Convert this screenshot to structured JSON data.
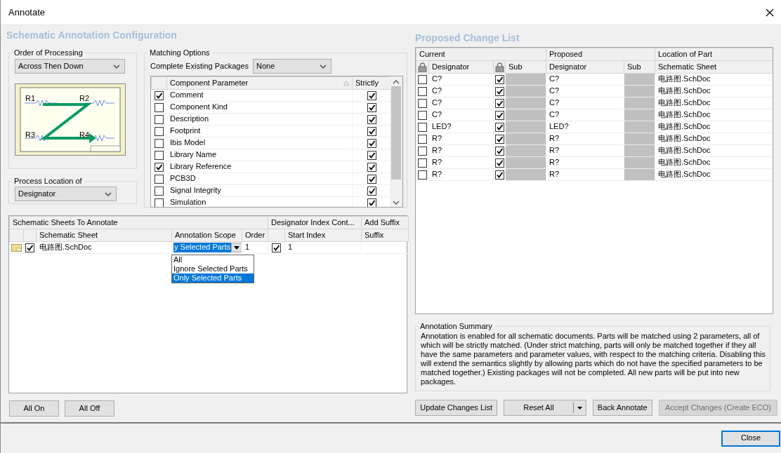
{
  "window": {
    "title": "Annotate"
  },
  "config_heading": "Schematic Annotation Configuration",
  "order_of_processing": {
    "label": "Order of Processing",
    "value": "Across Then Down",
    "diagram_labels": [
      "R1",
      "R2",
      "R3",
      "R4"
    ]
  },
  "process_location": {
    "label": "Process Location of",
    "value": "Designator"
  },
  "matching_options": {
    "label": "Matching Options",
    "complete_packages_label": "Complete Existing Packages",
    "complete_packages_value": "None",
    "columns": [
      "Component Parameter",
      "Strictly"
    ],
    "rows": [
      {
        "name": "Comment",
        "checked": true,
        "strictly": true
      },
      {
        "name": "Component Kind",
        "checked": false,
        "strictly": true
      },
      {
        "name": "Description",
        "checked": false,
        "strictly": true
      },
      {
        "name": "Footprint",
        "checked": false,
        "strictly": true
      },
      {
        "name": "Ibis Model",
        "checked": false,
        "strictly": true
      },
      {
        "name": "Library Name",
        "checked": false,
        "strictly": true
      },
      {
        "name": "Library Reference",
        "checked": true,
        "strictly": true
      },
      {
        "name": "PCB3D",
        "checked": false,
        "strictly": true
      },
      {
        "name": "Signal Integrity",
        "checked": false,
        "strictly": true
      },
      {
        "name": "Simulation",
        "checked": false,
        "strictly": true
      }
    ]
  },
  "sheets": {
    "group_headers": [
      "Schematic Sheets To Annotate",
      "Designator Index Cont...",
      "Add Suffix"
    ],
    "columns": [
      "Schematic Sheet",
      "Annotation Scope",
      "Order",
      "Start Index",
      "Suffix"
    ],
    "rows": [
      {
        "checked": true,
        "sheet": "电路图.SchDoc",
        "scope": "y Selected Parts",
        "order": "1",
        "start_index_checked": true,
        "start_index": "1"
      }
    ],
    "scope_options": [
      {
        "label": "All",
        "selected": false
      },
      {
        "label": "Ignore Selected Parts",
        "selected": false
      },
      {
        "label": "Only Selected Parts",
        "selected": true
      }
    ]
  },
  "left_buttons": [
    "All On",
    "All Off"
  ],
  "change_list": {
    "heading": "Proposed Change List",
    "group_headers": [
      "Current",
      "Proposed",
      "Location of Part"
    ],
    "columns": [
      "Designator",
      "Sub",
      "Designator",
      "Sub",
      "Schematic Sheet"
    ],
    "rows": [
      {
        "locked": false,
        "designator": "C?",
        "sub_locked": true,
        "proposed": "C?",
        "location": "电路图.SchDoc"
      },
      {
        "locked": false,
        "designator": "C?",
        "sub_locked": true,
        "proposed": "C?",
        "location": "电路图.SchDoc"
      },
      {
        "locked": false,
        "designator": "C?",
        "sub_locked": true,
        "proposed": "C?",
        "location": "电路图.SchDoc"
      },
      {
        "locked": false,
        "designator": "C?",
        "sub_locked": true,
        "proposed": "C?",
        "location": "电路图.SchDoc"
      },
      {
        "locked": false,
        "designator": "LED?",
        "sub_locked": true,
        "proposed": "LED?",
        "location": "电路图.SchDoc"
      },
      {
        "locked": false,
        "designator": "R?",
        "sub_locked": true,
        "proposed": "R?",
        "location": "电路图.SchDoc"
      },
      {
        "locked": false,
        "designator": "R?",
        "sub_locked": true,
        "proposed": "R?",
        "location": "电路图.SchDoc"
      },
      {
        "locked": false,
        "designator": "R?",
        "sub_locked": true,
        "proposed": "R?",
        "location": "电路图.SchDoc"
      },
      {
        "locked": false,
        "designator": "R?",
        "sub_locked": true,
        "proposed": "R?",
        "location": "电路图.SchDoc"
      }
    ]
  },
  "summary": {
    "label": "Annotation Summary",
    "text": "Annotation is enabled for all schematic documents. Parts will be matched using 2 parameters, all of which will be strictly matched. (Under strict matching, parts will only be matched together if they all have the same parameters and parameter values, with respect to the matching criteria. Disabling this will extend the semantics slightly by allowing parts which do not have the specified parameters to be matched together.) Existing packages will not be completed. All new parts will be put into new packages."
  },
  "actions": [
    {
      "label": "Update Changes List",
      "kind": "button",
      "disabled": false
    },
    {
      "label": "Reset All",
      "kind": "split",
      "disabled": false
    },
    {
      "label": "Back Annotate",
      "kind": "button",
      "disabled": false
    },
    {
      "label": "Accept Changes (Create ECO)",
      "kind": "button",
      "disabled": true
    }
  ],
  "close_button": {
    "label": "Close",
    "focused": true
  }
}
